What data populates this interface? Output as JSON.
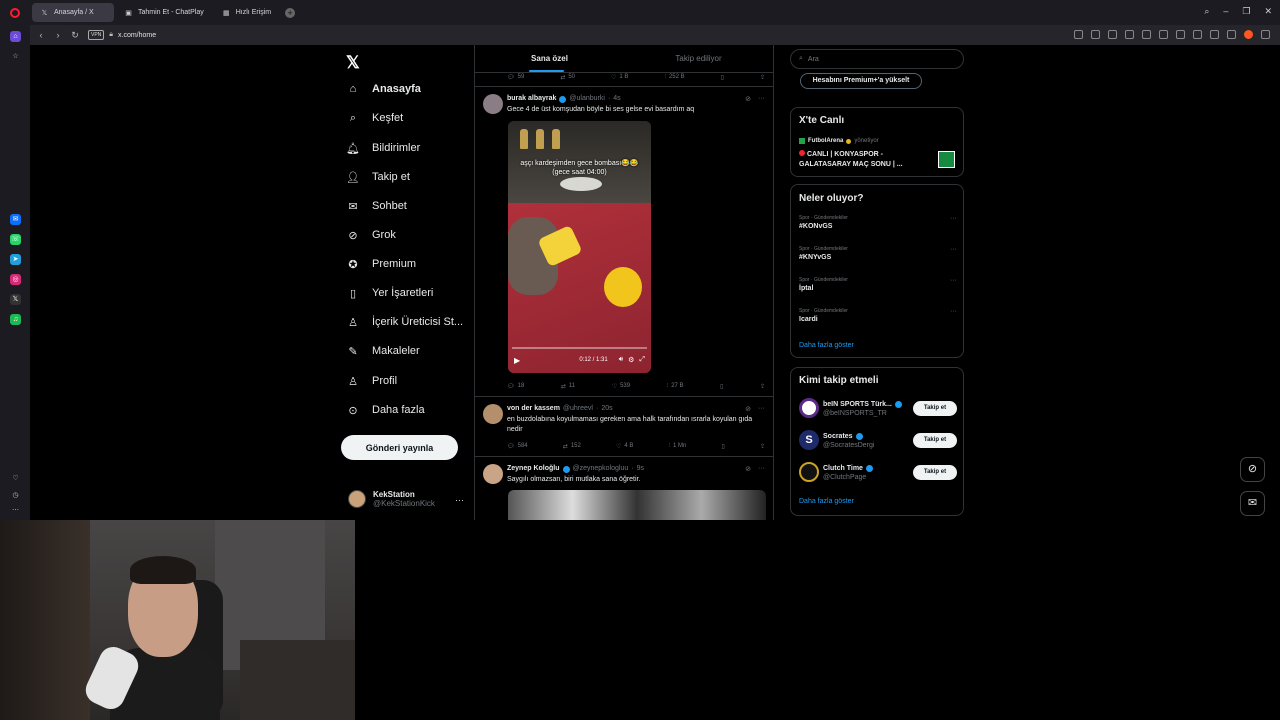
{
  "browser": {
    "tabs": [
      {
        "label": "Anasayfa / X",
        "icon": "x-icon"
      },
      {
        "label": "Tahmin Et - ChatPlay",
        "icon": "chatplay-icon"
      },
      {
        "label": "Hızlı Erişim",
        "icon": "grid-icon"
      }
    ],
    "url": "x.com/home",
    "vpn_label": "VPN"
  },
  "nav": {
    "items": [
      {
        "label": "Anasayfa",
        "icon": "home-icon"
      },
      {
        "label": "Keşfet",
        "icon": "search-icon"
      },
      {
        "label": "Bildirimler",
        "icon": "bell-icon"
      },
      {
        "label": "Takip et",
        "icon": "add-user-icon"
      },
      {
        "label": "Sohbet",
        "icon": "mail-icon"
      },
      {
        "label": "Grok",
        "icon": "grok-icon"
      },
      {
        "label": "Premium",
        "icon": "premium-icon"
      },
      {
        "label": "Yer İşaretleri",
        "icon": "bookmark-icon"
      },
      {
        "label": "İçerik Üreticisi St...",
        "icon": "creator-icon"
      },
      {
        "label": "Makaleler",
        "icon": "article-icon"
      },
      {
        "label": "Profil",
        "icon": "person-icon"
      },
      {
        "label": "Daha fazla",
        "icon": "more-icon"
      }
    ],
    "post_button": "Gönderi yayınla",
    "profile": {
      "name": "KekStation",
      "handle": "@KekStationKick"
    }
  },
  "timeline": {
    "tabs": [
      "Sana özel",
      "Takip ediliyor"
    ],
    "top_actions": {
      "replies": "59",
      "reposts": "50",
      "likes": "1 B",
      "views": "252 B"
    },
    "tweets": [
      {
        "name": "burak albayrak",
        "handle": "@ulanburki",
        "time": "4s",
        "text": "Gece 4 de üst komşudan böyle bi ses gelse evi basardım aq",
        "video_caption_1": "aşçı kardeşimden gece bombası😂😂",
        "video_caption_2": "(gece saat 04:00)",
        "video_time": "0:12 / 1:31",
        "actions": {
          "replies": "18",
          "reposts": "11",
          "likes": "539",
          "views": "27 B"
        }
      },
      {
        "name": "von der kassem",
        "handle": "@uhreevl",
        "time": "20s",
        "text": "en buzdolabına koyulmaması gereken ama halk tarafından ısrarla koyulan gıda nedir",
        "actions": {
          "replies": "584",
          "reposts": "152",
          "likes": "4 B",
          "views": "1 Mn"
        }
      },
      {
        "name": "Zeynep Koloğlu",
        "handle": "@zeynepkologluu",
        "time": "9s",
        "text": "Saygılı olmazsan, biri mutlaka sana öğretir."
      }
    ]
  },
  "right": {
    "search_placeholder": "Ara",
    "premium_button": "Hesabını Premium+'a yükselt",
    "live": {
      "title": "X'te Canlı",
      "source": "FutbolArena",
      "source_suffix": "yönetiyor",
      "stream": "CANLI | KONYASPOR - GALATASARAY MAÇ SONU | ..."
    },
    "trends": {
      "title": "Neler oluyor?",
      "items": [
        {
          "category": "Spor · Gündemdekiler",
          "topic": "#KONvGS"
        },
        {
          "category": "Spor · Gündemdekiler",
          "topic": "#KNYvGS"
        },
        {
          "category": "Spor · Gündemdekiler",
          "topic": "İptal"
        },
        {
          "category": "Spor · Gündemdekiler",
          "topic": "Icardi"
        }
      ],
      "more": "Daha fazla göster"
    },
    "who_to_follow": {
      "title": "Kimi takip etmeli",
      "items": [
        {
          "name": "beIN SPORTS Türk...",
          "handle": "@beINSPORTS_TR",
          "button": "Takip et"
        },
        {
          "name": "Socrates",
          "handle": "@SocratesDergi",
          "button": "Takip et"
        },
        {
          "name": "Clutch Time",
          "handle": "@ClutchPage",
          "button": "Takip et"
        }
      ],
      "more": "Daha fazla göster"
    }
  },
  "colors": {
    "accent": "#1d9bf0",
    "background": "#000000",
    "border": "#2f3336"
  }
}
